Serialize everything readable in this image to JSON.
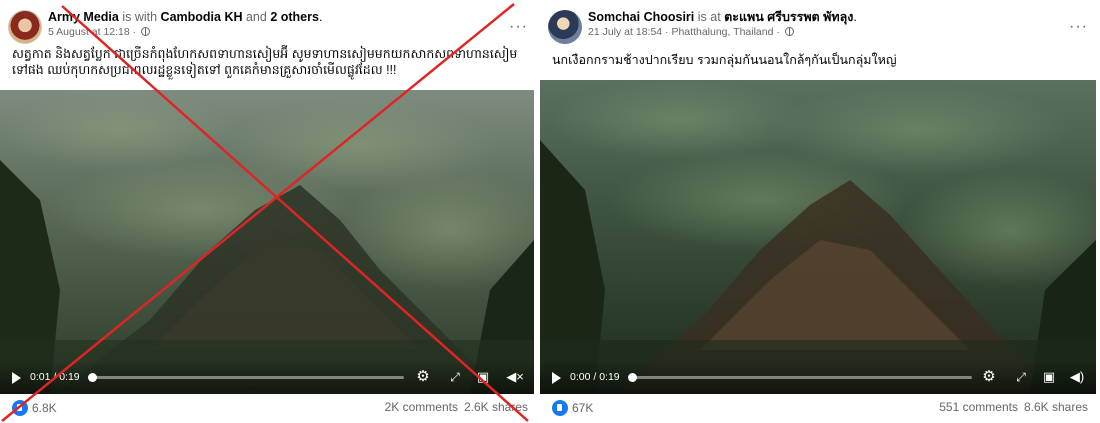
{
  "posts": [
    {
      "author": "Army Media",
      "with_text": " is with ",
      "tagged": "Cambodia KH",
      "and_text": " and ",
      "others": "2 others",
      "period": ".",
      "timestamp": "5 August at 12:18 ·",
      "caption": "សត្វកាត និងសត្វប្លែក ជាច្រើនកំពុងហែកសពទាហានសៀមអ៊ី សូមទាហានសៀមមកយកសាកសពទាហានសៀមទៅផង ឈប់កុហកសប្រជាពលរដ្ឋខ្លួនទៀតទៅ ពួកគេកំមានគ្រួសារចាំមើលផ្លូវដែល !!!",
      "video_time": "0:01 / 0:19",
      "likes": "6.8K",
      "comments": "2K comments",
      "shares": "2.6K shares",
      "debunk_mark": "red-x-mark"
    },
    {
      "author": "Somchai Choosiri",
      "at_text": " is at ",
      "place": "ตะแพน ศรีบรรพต พัทลุง",
      "period": ".",
      "timestamp": "21 July at 18:54 · Phatthalung, Thailand ·",
      "caption": "นกเงือกกรามช้างปากเรียบ รวมกลุ่มกันนอนใกล้ๆกันเป็นกลุ่มใหญ่",
      "video_time": "0:00 / 0:19",
      "likes": "67K",
      "comments": "551 comments",
      "shares": "8.6K shares"
    }
  ],
  "colors": {
    "accent": "#1877f2",
    "cross": "#e02424",
    "muted": "#65676b"
  },
  "icons": [
    "more-icon",
    "globe-icon",
    "play-icon",
    "settings-icon",
    "expand-icon",
    "pip-icon",
    "volume-icon",
    "like-icon"
  ]
}
